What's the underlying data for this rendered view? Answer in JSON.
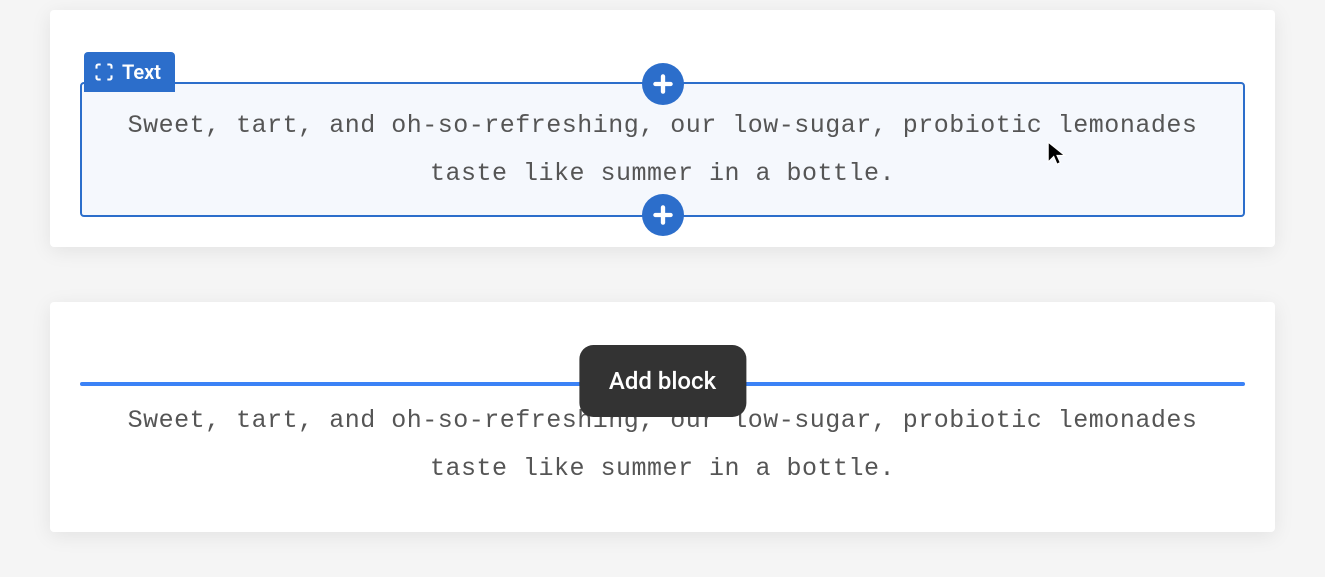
{
  "block1": {
    "label": "Text",
    "content": "Sweet, tart, and oh-so-refreshing, our low-sugar, probiotic lemonades taste like summer in a bottle."
  },
  "block2": {
    "content": "Sweet, tart, and oh-so-refreshing, our low-sugar, probiotic lemonades taste like summer in a bottle.",
    "tooltip": "Add block"
  }
}
